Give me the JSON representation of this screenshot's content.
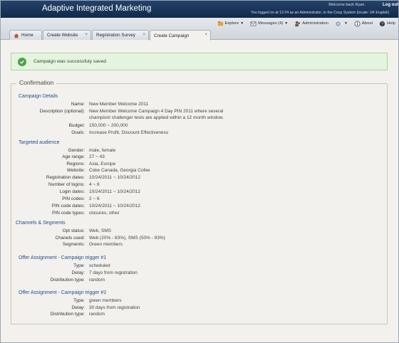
{
  "header": {
    "title": "Adaptive Integrated Marketing",
    "welcome": "Welcome back Ryan.",
    "logout": "Log out",
    "logged_on": "You  logged on at 12:24 as an Administrator, to the Coop System (locale: UK English)"
  },
  "toolbar": {
    "explore": "Explore",
    "messages": "Messages (4)",
    "administration": "Administration",
    "about": "About",
    "help": "Help"
  },
  "tabs": [
    {
      "label": "Home",
      "icon": "home-icon"
    },
    {
      "label": "Create Website"
    },
    {
      "label": "Registration Survey"
    },
    {
      "label": "Create Campaign",
      "active": true
    }
  ],
  "success_message": "Campaign was successfuly saved",
  "legend": "Confirmation",
  "sections": {
    "campaign_details": "Campaign Details",
    "targeted_audience": "Targeted audience",
    "channels_segments": "Channels & Segments",
    "offer1": "Offer Assignment - Campaign trigger #1",
    "offer2": "Offer Assignment - Campaign trigger #2"
  },
  "campaign_details": [
    {
      "label": "Name:",
      "value": "New Member Welcome 2011"
    },
    {
      "label": "Description (optional):",
      "value": "New Member Welcome Campaign 4 Day PIN 2011 where several",
      "value2": "champion/ challenger tests are applied within a 12 month window."
    },
    {
      "label": "Budget:",
      "value": "150,000  ~ 200,000"
    },
    {
      "label": "Goals:",
      "value": "Increase Profit,  Discount Effectiveness"
    }
  ],
  "targeted_audience": [
    {
      "label": "Gender:",
      "value": "male, female"
    },
    {
      "label": "Age range:",
      "value": "27  ~  43"
    },
    {
      "label": "Regions:",
      "value": "Asia,  Europe"
    },
    {
      "label": "Website:",
      "value": "Coke Canada, Georgia Cofee"
    },
    {
      "label": "Registration dates:",
      "value": "10/24/2011  ~  10/24/2012"
    },
    {
      "label": "Number of logins:",
      "value": "4 ~  8"
    },
    {
      "label": "Login dates:",
      "value": "10/24/2011  ~  10/24/2012"
    },
    {
      "label": "PIN codes:",
      "value": "2  ~  6"
    },
    {
      "label": "PIN code dates:",
      "value": "10/24/2011  ~  10/24/2012"
    },
    {
      "label": "PIN code types:",
      "value": "closures,  other"
    }
  ],
  "channels_segments": [
    {
      "label": "Opt status:",
      "value": "Web, SMS"
    },
    {
      "label": "Chanels used:",
      "value": "Web (20% - 83%), SMS  (50% - 93%)"
    },
    {
      "label": "Segments:",
      "value": "Green members"
    }
  ],
  "offer1": [
    {
      "label": "Type:",
      "value": "scheduled"
    },
    {
      "label": "Delay:",
      "value": "7 days from registration"
    },
    {
      "label": "Distribution type:",
      "value": "random"
    }
  ],
  "offer2": [
    {
      "label": "Type:",
      "value": "green members"
    },
    {
      "label": "Delay:",
      "value": "30 days from registration"
    },
    {
      "label": "Distribution type:",
      "value": "random"
    }
  ]
}
